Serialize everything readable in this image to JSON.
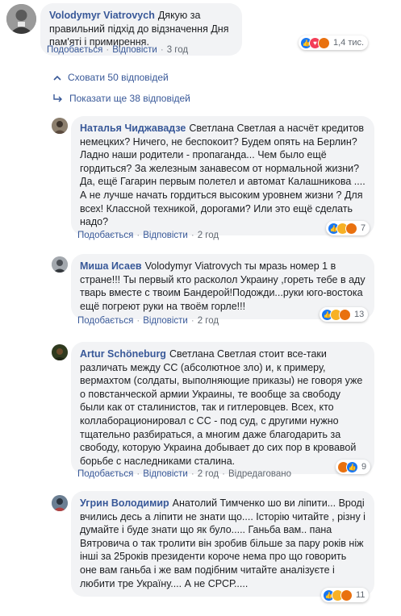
{
  "top_comment": {
    "author": "Volodymyr Viatrovych",
    "text": "Дякую за правильний підхід до відзначення Дня пам'яті і примирення.",
    "like_label": "Подобається",
    "reply_label": "Відповісти",
    "time": "3 год",
    "reaction_count": "1,4 тис."
  },
  "hide_replies_label": "Сховати 50 відповідей",
  "show_more_label": "Показати ще 38 відповідей",
  "replies": [
    {
      "author": "Наталья Чиджавадзе",
      "text": "Светлана Светлая а насчёт кредитов немецких? Ничего, не беспокоит? Будем опять на Берлин? Ладно наши родители - пропаганда... Чем было ещё гордиться? За железным занавесом от нормальной жизни? Да, ещё Гагарин первым полетел и автомат Калашникова .... А не лучше начать гордиться высоким уровнем жизни ? Для всех! Классной техникой, дорогами? Или это ещё сделать надо?",
      "like_label": "Подобається",
      "reply_label": "Відповісти",
      "time": "2 год",
      "reaction_count": "7"
    },
    {
      "author": "Миша Исаев",
      "text": "Volodymyr Viatrovych ты мразь номер 1 в стране!!! Ты первый кто расколол Украину ,гореть тебе в аду тварь вместе с твоим Бандерой!Подожди...руки юго-востока ещё погреют руки на твоём горле!!!",
      "like_label": "Подобається",
      "reply_label": "Відповісти",
      "time": "2 год",
      "reaction_count": "13"
    },
    {
      "author": "Artur Schöneburg",
      "text": "Светлана Светлая стоит все-таки различать между СС (абсолютное зло) и, к примеру, вермахтом (солдаты, выполняющие приказы) не говоря уже о повстанческой армии Украины, те вообще за свободу были как от сталинистов, так и гитлеровцев. Всех, кто коллаборационировал с СС - под суд, с другими нужно тщательно разбираться, а многим даже благодарить за свободу, которую Украина добывает до сих пор в кровавой борьбе с наследниками сталина.",
      "like_label": "Подобається",
      "reply_label": "Відповісти",
      "time": "2 год",
      "edited_label": "Відредаговано",
      "reaction_count": "9"
    },
    {
      "author": "Угрин Володимир",
      "text": "Анатолий Тимченко шо ви ліпити... Вроді вчились десь а ліпити не знати що.... Історію читайте , різну і думайте і буде знати що як було..... Ганьба вам.. пана Вятровича о так тролити він зробив більше за пару років ніж інші за 25років президенти короче нема про що говорить оне вам ганьба і же вам подібним читайте аналізуєте і любити тре Україну.... А не СРСР.....",
      "reaction_count": "11"
    }
  ],
  "colors": {
    "link": "#385898",
    "bubble": "#f2f3f5",
    "meta": "#606770"
  }
}
